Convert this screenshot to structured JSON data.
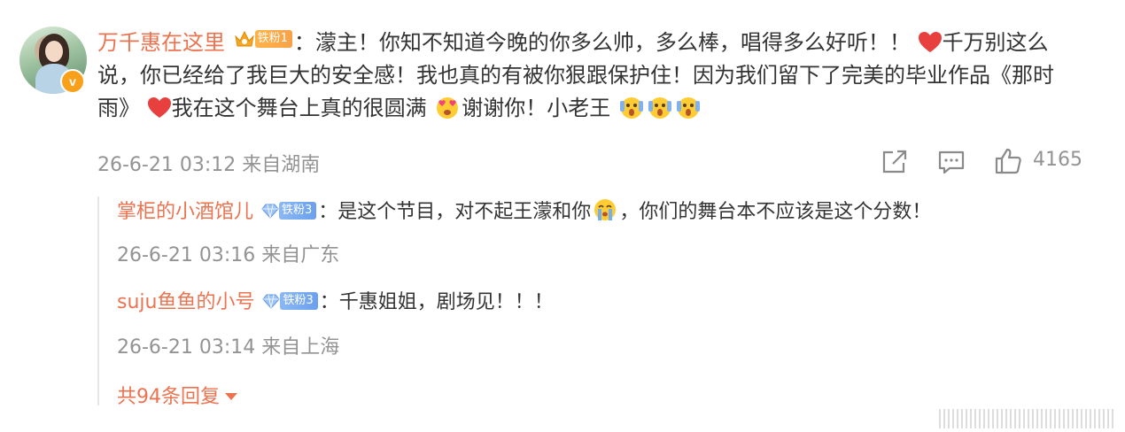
{
  "comment": {
    "username": "万千惠在这里",
    "fan_badge": "铁粉1",
    "colon": "：",
    "text_part1": "濛主！你知不知道今晚的你多么帅，多么棒，唱得多么好听！！",
    "text_part2": "千万别这么说，你已经给了我巨大的安全感！我也真的有被你狠跟保护住！因为我们留下了完美的毕业作品《那时雨》",
    "text_part3": "我在这个舞台上真的很圆满",
    "text_part4": "谢谢你！小老王",
    "timestamp": "26-6-21 03:12 来自湖南",
    "like_count": "4165"
  },
  "replies": [
    {
      "username": "掌柜的小酒馆儿",
      "fan_badge": "铁粉3",
      "text_part1": "：是这个节目，对不起王濛和你",
      "text_part2": "，你们的舞台本不应该是这个分数！",
      "timestamp": "26-6-21 03:16 来自广东"
    },
    {
      "username": "suju鱼鱼的小号",
      "fan_badge": "铁粉3",
      "text_part1": "：千惠姐姐，剧场见！！！",
      "timestamp": "26-6-21 03:14 来自上海"
    }
  ],
  "more_replies": "共94条回复",
  "icons": {
    "verified": "v-badge-icon",
    "share": "share-icon",
    "comment": "comment-icon",
    "like": "thumbs-up-icon",
    "expand": "caret-down-icon"
  },
  "colors": {
    "username": "#eb7350",
    "meta": "#939393",
    "text": "#333333"
  }
}
